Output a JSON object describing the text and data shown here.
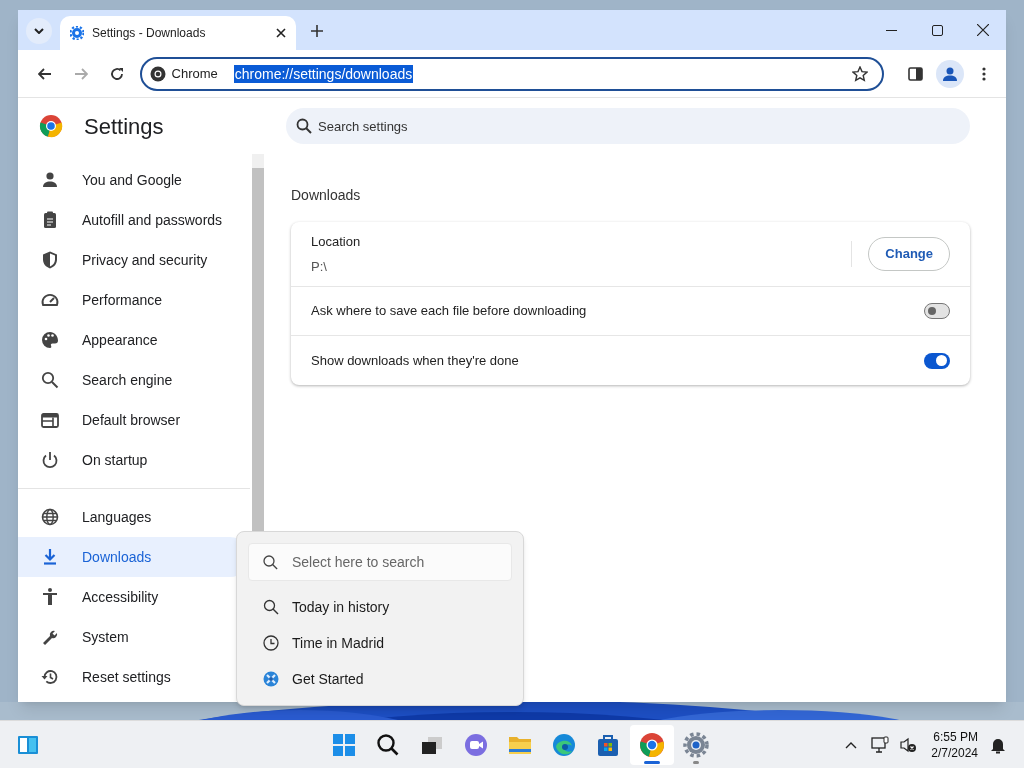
{
  "browser": {
    "tabs": [
      {
        "title": "Settings - Downloads",
        "selected": true
      }
    ],
    "address_bar": {
      "chip": "Chrome",
      "url": "chrome://settings/downloads",
      "url_selected": true
    }
  },
  "settings": {
    "title": "Settings",
    "search": {
      "placeholder": "Search settings"
    },
    "sidebar": {
      "groups": [
        [
          {
            "label": "You and Google",
            "selected": false
          },
          {
            "label": "Autofill and passwords",
            "selected": false
          },
          {
            "label": "Privacy and security",
            "selected": false
          },
          {
            "label": "Performance",
            "selected": false
          },
          {
            "label": "Appearance",
            "selected": false
          },
          {
            "label": "Search engine",
            "selected": false
          },
          {
            "label": "Default browser",
            "selected": false
          },
          {
            "label": "On startup",
            "selected": false
          }
        ],
        [
          {
            "label": "Languages",
            "selected": false
          },
          {
            "label": "Downloads",
            "selected": true
          },
          {
            "label": "Accessibility",
            "selected": false
          },
          {
            "label": "System",
            "selected": false
          },
          {
            "label": "Reset settings",
            "selected": false
          }
        ]
      ]
    },
    "section": {
      "title": "Downloads",
      "location": {
        "label": "Location",
        "value": "P:\\",
        "button": "Change"
      },
      "toggles": [
        {
          "label": "Ask where to save each file before downloading",
          "on": false
        },
        {
          "label": "Show downloads when they're done",
          "on": true
        }
      ]
    }
  },
  "search_popup": {
    "placeholder": "Select here to search",
    "items": [
      {
        "label": "Today in history"
      },
      {
        "label": "Time in Madrid"
      },
      {
        "label": "Get Started"
      }
    ]
  },
  "taskbar": {
    "apps": [
      {
        "running": false,
        "selected": false
      },
      {
        "running": false,
        "selected": false
      },
      {
        "running": false,
        "selected": false
      },
      {
        "running": false,
        "selected": false
      },
      {
        "running": false,
        "selected": false
      },
      {
        "running": false,
        "selected": false
      },
      {
        "running": false,
        "selected": false
      },
      {
        "running": true,
        "selected": true
      },
      {
        "running": true,
        "selected": false
      }
    ],
    "clock": {
      "time": "6:55 PM",
      "date": "2/7/2024"
    }
  }
}
